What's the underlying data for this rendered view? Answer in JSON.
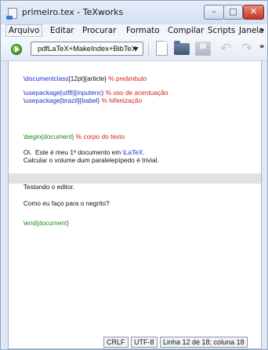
{
  "window": {
    "title": "primeiro.tex - TeXworks",
    "minimize_glyph": "–",
    "maximize_glyph": "□",
    "close_glyph": "✕"
  },
  "menu": {
    "items": [
      "Arquivo",
      "Editar",
      "Procurar",
      "Formato",
      "Compilar",
      "Scripts",
      "Janela"
    ],
    "overflow": "»"
  },
  "toolbar": {
    "typeset_engine": "pdfLaTeX+MakeIndex+BibTeX",
    "overflow": "»",
    "icons": [
      "typeset-icon",
      "new-document-icon",
      "open-folder-icon",
      "save-icon",
      "undo-icon",
      "redo-icon"
    ]
  },
  "editor": {
    "lines": [
      {
        "parts": [
          {
            "t": "\\documentclass",
            "k": "cmd"
          },
          {
            "t": "[12pt]{article} ",
            "k": "txt"
          },
          {
            "t": "% preâmbulo",
            "k": "cmt"
          }
        ]
      },
      {
        "parts": [
          {
            "t": "\\usepackage",
            "k": "cmd"
          },
          {
            "t": "[utf8]{inputenc} ",
            "k": "cmd"
          },
          {
            "t": "% uso de acentuação",
            "k": "cmt"
          }
        ]
      },
      {
        "parts": [
          {
            "t": "\\usepackage",
            "k": "cmd"
          },
          {
            "t": "[brazil]{babel} ",
            "k": "cmd"
          },
          {
            "t": "% hifenização",
            "k": "cmt"
          }
        ]
      },
      {
        "parts": [
          {
            "t": "\\begin{document} ",
            "k": "env"
          },
          {
            "t": "% corpo do texto",
            "k": "cmt"
          }
        ]
      },
      {
        "parts": [
          {
            "t": "Oi.  Este é meu 1º documento em ",
            "k": "txt"
          },
          {
            "t": "\\LaTeX",
            "k": "cmd"
          },
          {
            "t": ".",
            "k": "txt"
          }
        ]
      },
      {
        "parts": [
          {
            "t": "Calcular o volume dum paralelepípedo é trivial.",
            "k": "txt"
          }
        ]
      },
      {
        "parts": [
          {
            "t": "Testando o editor.",
            "k": "txt"
          }
        ]
      },
      {
        "parts": [
          {
            "t": "Como eu faço para o negrito?",
            "k": "txt"
          }
        ]
      },
      {
        "parts": [
          {
            "t": "\\end{document}",
            "k": "env"
          }
        ]
      }
    ]
  },
  "status": {
    "line_ending": "CRLF",
    "encoding": "UTF-8",
    "position": "Linha 12 de 18; coluna 18"
  },
  "colors": {
    "command": "#1f2fcf",
    "comment": "#d11f1f",
    "environment": "#1e8a1e",
    "current_line": "#e2e2e2"
  }
}
